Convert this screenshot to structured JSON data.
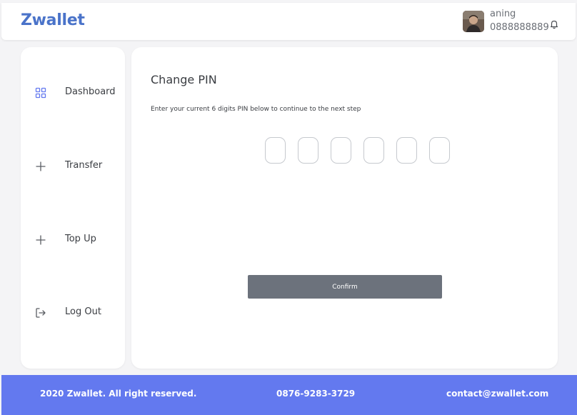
{
  "header": {
    "brand": "Zwallet",
    "user": {
      "name": "aning",
      "phone": "0888888889"
    },
    "icons": {
      "avatar": "user-avatar",
      "notification": "bell-icon"
    }
  },
  "sidebar": {
    "items": [
      {
        "label": "Dashboard",
        "icon": "grid-icon",
        "active": true
      },
      {
        "label": "Transfer",
        "icon": "plus-icon"
      },
      {
        "label": "Top Up",
        "icon": "plus-icon"
      },
      {
        "label": "Log Out",
        "icon": "logout-icon"
      }
    ]
  },
  "main": {
    "title": "Change PIN",
    "description": "Enter your current 6 digits PIN below to continue to the next step",
    "pin": {
      "digits": 6,
      "values": [
        "",
        "",
        "",
        "",
        "",
        ""
      ]
    },
    "confirm_label": "Confirm"
  },
  "footer": {
    "copyright": "2020 Zwallet. All right reserved.",
    "phone": "0876-9283-3729",
    "email": "contact@zwallet.com"
  },
  "colors": {
    "brand": "#4a73c9",
    "footer": "#6379ef",
    "button": "#6c727c",
    "active_icon": "#6379ef"
  }
}
